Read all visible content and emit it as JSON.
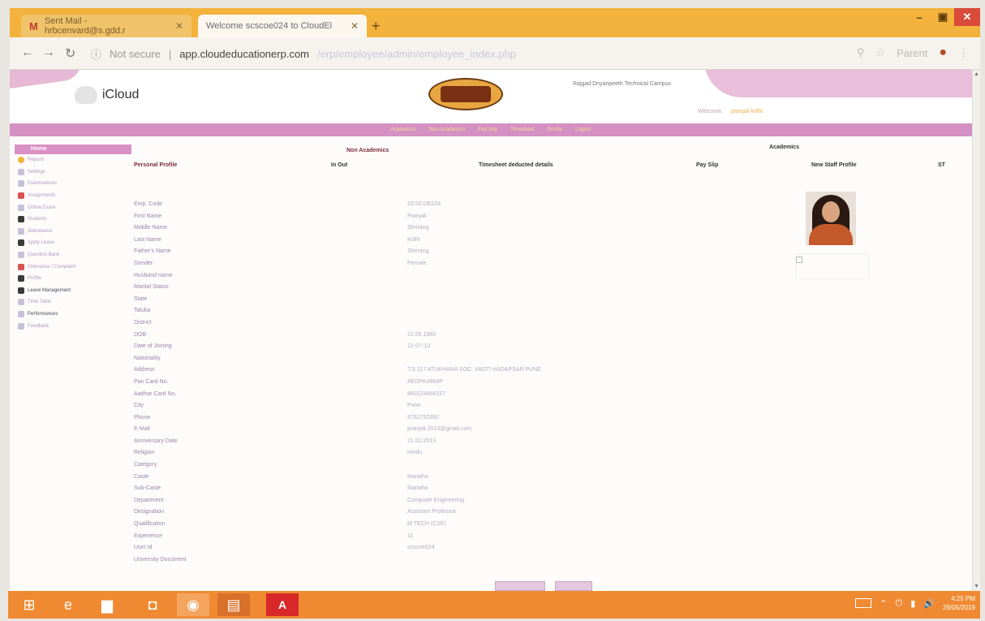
{
  "browser": {
    "tabs": [
      {
        "label": "Sent Mail - hrbcenvard@s.gdd.r"
      },
      {
        "label": "Welcome scscoe024 to CloudEl"
      }
    ],
    "new_tab": "+",
    "window": {
      "min": "–",
      "max": "▣",
      "close": "✕"
    },
    "not_secure": "Not secure",
    "url": "app.cloudeducationerp.com",
    "url_path": "/erp/employee/admin/employee_index.php",
    "profile": "Parent"
  },
  "header": {
    "brand": "iCloud",
    "campus": "Rajgad Dnyanpeeth Technical Campus",
    "welcome_label": "Welcome,",
    "welcome_user": "pranjali kolhi"
  },
  "menubar": [
    "Academics",
    "Non-Academics",
    "Pay Slip",
    "Timesheet",
    "Profile",
    "Logout"
  ],
  "sidebar": {
    "title": "Home",
    "items": [
      {
        "label": "Reports",
        "icon": "star-icon",
        "dark": false
      },
      {
        "label": "Settings",
        "icon": "gear-icon",
        "dark": false
      },
      {
        "label": "Examinations",
        "icon": "check-icon",
        "dark": false
      },
      {
        "label": "Assignments",
        "icon": "book-icon",
        "dark": false
      },
      {
        "label": "Online Exam",
        "icon": "pencil-icon",
        "dark": false
      },
      {
        "label": "Students",
        "icon": "user-icon",
        "dark": false
      },
      {
        "label": "Attendance",
        "icon": "calendar-icon",
        "dark": false
      },
      {
        "label": "Apply Leave",
        "icon": "person-walk-icon",
        "dark": false
      },
      {
        "label": "Question Bank",
        "icon": "question-icon",
        "dark": false
      },
      {
        "label": "Grievance / Complaint",
        "icon": "clipboard-icon",
        "dark": false
      },
      {
        "label": "Profile",
        "icon": "user-icon",
        "dark": false
      },
      {
        "label": "Leave Management",
        "icon": "person-icon",
        "dark": true
      },
      {
        "label": "Time Table",
        "icon": "clock-icon",
        "dark": false
      },
      {
        "label": "Performances",
        "icon": "chart-icon",
        "dark": true
      },
      {
        "label": "Feedback",
        "icon": "chat-icon",
        "dark": false
      }
    ]
  },
  "content": {
    "non_academics": "Non Academics",
    "academics": "Academics",
    "tabs": [
      "Personal Profile",
      "In Out",
      "Timesheet deducted details",
      "Pay Slip",
      "New Staff Profile",
      "ST"
    ],
    "fields": [
      {
        "label": "Emp. Code",
        "value": "SCSCOE024"
      },
      {
        "label": "First Name",
        "value": "Pranjali"
      },
      {
        "label": "Middle Name",
        "value": "Shrirang"
      },
      {
        "label": "Last Name",
        "value": "Kolhi"
      },
      {
        "label": "Father's Name",
        "value": "Shrirang"
      },
      {
        "label": "Gender",
        "value": "Female"
      },
      {
        "label": "Husband name",
        "value": ""
      },
      {
        "label": "Marital Status",
        "value": ""
      },
      {
        "label": "State",
        "value": ""
      },
      {
        "label": "Taluka",
        "value": ""
      },
      {
        "label": "District",
        "value": ""
      },
      {
        "label": "DOB",
        "value": "21.05.1983"
      },
      {
        "label": "Date of Joining",
        "value": "12-07-13"
      },
      {
        "label": "Nationality",
        "value": ""
      },
      {
        "label": "Address",
        "value": "T.S 117 ATUKHANA SOC. VADTI HADAPSAR PUNE"
      },
      {
        "label": "Pan Card No.",
        "value": "AEDPK4968P"
      },
      {
        "label": "Aadhar Card No.",
        "value": "860224464237"
      },
      {
        "label": "City",
        "value": "Pune"
      },
      {
        "label": "Phone",
        "value": "9762752392"
      },
      {
        "label": "E-Mail",
        "value": "pranjali.2013@gmail.com"
      },
      {
        "label": "Anniversary Date",
        "value": "21.02.2013"
      },
      {
        "label": "Religion",
        "value": "Hindu"
      },
      {
        "label": "Category",
        "value": ""
      },
      {
        "label": "Caste",
        "value": "Maratha"
      },
      {
        "label": "Sub-Caste",
        "value": "Maratha"
      },
      {
        "label": "Department",
        "value": "Computer Engineering"
      },
      {
        "label": "Designation",
        "value": "Assistant Professor"
      },
      {
        "label": "Qualification",
        "value": "M.TECH (CSE)"
      },
      {
        "label": "Experience",
        "value": "11"
      },
      {
        "label": "User Id",
        "value": "scscoe024"
      },
      {
        "label": "University Document",
        "value": ""
      }
    ]
  },
  "taskbar": {
    "apps": [
      "windows-icon",
      "ie-icon",
      "folder-icon",
      "store-icon",
      "chrome-icon",
      "document-icon",
      "pdf-icon"
    ],
    "clock_time": "4:25 PM",
    "clock_date": "29/05/2019"
  }
}
